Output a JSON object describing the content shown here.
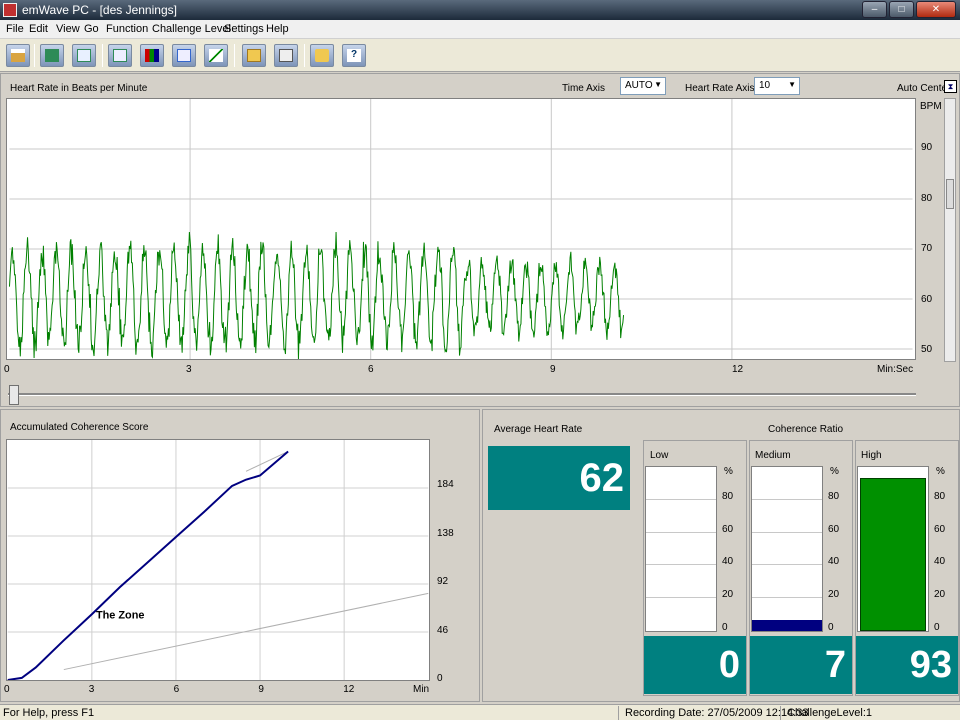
{
  "window": {
    "title": "emWave PC - [des Jennings]",
    "min_label": "–",
    "max_label": "□",
    "close_label": "✕"
  },
  "menu": [
    "File",
    "Edit",
    "View",
    "Go",
    "Function",
    "Challenge Level",
    "Settings",
    "Help"
  ],
  "toolbar": {
    "icons": [
      "home-icon",
      "heart-rate-icon",
      "hrv-wave-icon",
      "session-graph-icon",
      "bar-chart-icon",
      "spectrum-icon",
      "trend-graph-icon",
      "open-file-icon",
      "print-icon",
      "sound-icon",
      "help-icon"
    ]
  },
  "hr_panel": {
    "title": "Heart Rate in Beats per Minute",
    "time_axis_label": "Time Axis",
    "time_axis_value": "AUTO",
    "hr_axis_label": "Heart Rate Axis",
    "hr_axis_value": "10",
    "auto_center_label": "Auto Center",
    "auto_center_icon": "auto-center-icon"
  },
  "hr_chart": {
    "type": "line",
    "y_unit": "BPM",
    "x_unit": "Min:Sec",
    "x_ticks": [
      "0",
      "3",
      "6",
      "9",
      "12"
    ],
    "y_ticks": [
      "90",
      "80",
      "70",
      "60",
      "50"
    ],
    "xlim": [
      0,
      15
    ],
    "ylim": [
      48,
      100
    ],
    "series_color": "#008000"
  },
  "coherence_panel": {
    "title": "Accumulated Coherence Score",
    "zone_label": "The Zone"
  },
  "chart_data": [
    {
      "type": "line",
      "title": "Accumulated Coherence Score",
      "x_ticks": [
        "0",
        "3",
        "6",
        "9",
        "12"
      ],
      "x_unit": "Min",
      "y_ticks": [
        "184",
        "138",
        "92",
        "46",
        "0"
      ],
      "xlim": [
        0,
        15
      ],
      "ylim": [
        0,
        230
      ],
      "series": [
        {
          "x": [
            0,
            0.5,
            1,
            2,
            3,
            4,
            5,
            6,
            7,
            8,
            8.5,
            9,
            10
          ],
          "y": [
            0,
            2,
            12,
            38,
            63,
            89,
            113,
            137,
            161,
            186,
            192,
            196,
            219
          ],
          "color": "#000080"
        }
      ],
      "zone_lines": [
        {
          "x": [
            8.5,
            10
          ],
          "y": [
            200,
            219
          ],
          "color": "#b0b0b0"
        },
        {
          "x": [
            2,
            15
          ],
          "y": [
            10,
            83
          ],
          "color": "#b0b0b0"
        }
      ]
    },
    {
      "type": "bar",
      "title": "Coherence Ratio",
      "categories": [
        "Low",
        "Medium",
        "High"
      ],
      "values": [
        0,
        7,
        93
      ],
      "ylim": [
        0,
        100
      ],
      "y_ticks": [
        "%",
        "80",
        "60",
        "40",
        "20",
        "0"
      ]
    }
  ],
  "stats": {
    "avg_hr_label": "Average Heart Rate",
    "avg_hr_value": "62",
    "coherence_ratio_label": "Coherence Ratio",
    "low_label": "Low",
    "medium_label": "Medium",
    "high_label": "High",
    "low_value": "0",
    "medium_value": "7",
    "high_value": "93",
    "low_color": "#ffffff",
    "medium_color": "#000080",
    "high_color": "#009000"
  },
  "statusbar": {
    "help": "For Help, press F1",
    "recording_date": "Recording Date: 27/05/2009 12:14:33",
    "challenge": "ChallengeLevel:1"
  }
}
